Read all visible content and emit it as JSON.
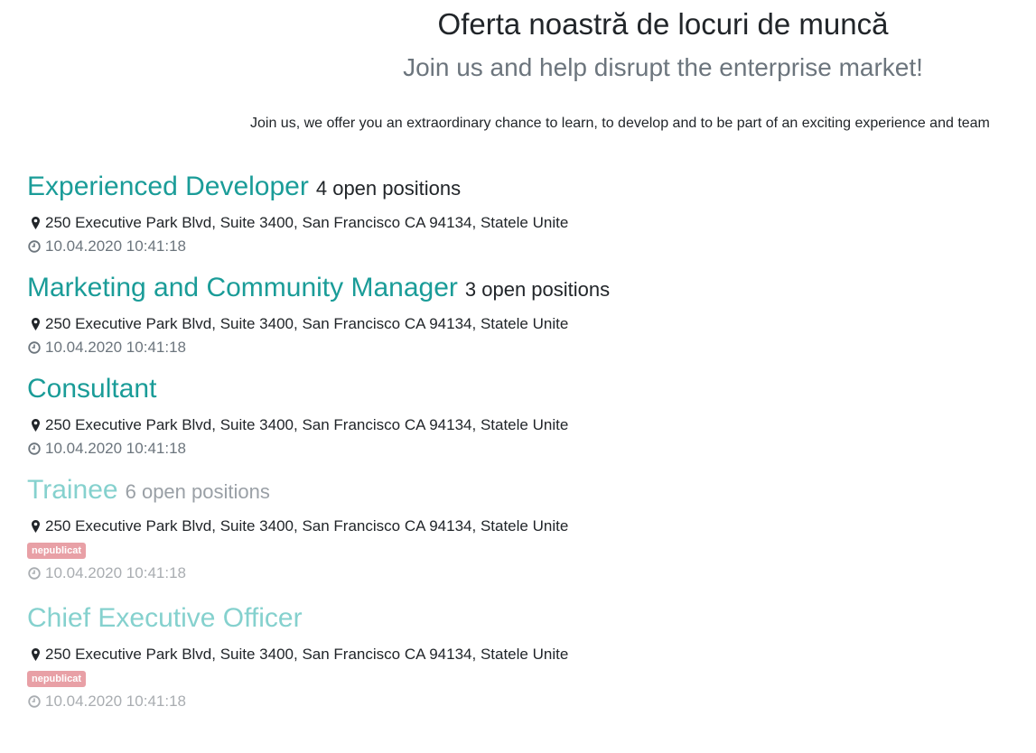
{
  "header": {
    "title": "Oferta noastră de locuri de muncă",
    "subtitle": "Join us and help disrupt the enterprise market!",
    "intro": "Join us, we offer you an extraordinary chance to learn, to develop and to be part of an exciting experience and team"
  },
  "jobs": [
    {
      "title": "Experienced Developer",
      "openings": "4 open positions",
      "address": "250 Executive Park Blvd, Suite 3400, San Francisco CA 94134, Statele Unite",
      "date": "10.04.2020 10:41:18",
      "published": true,
      "badge": ""
    },
    {
      "title": "Marketing and Community Manager",
      "openings": "3 open positions",
      "address": "250 Executive Park Blvd, Suite 3400, San Francisco CA 94134, Statele Unite",
      "date": "10.04.2020 10:41:18",
      "published": true,
      "badge": ""
    },
    {
      "title": "Consultant",
      "openings": "",
      "address": "250 Executive Park Blvd, Suite 3400, San Francisco CA 94134, Statele Unite",
      "date": "10.04.2020 10:41:18",
      "published": true,
      "badge": ""
    },
    {
      "title": "Trainee",
      "openings": "6 open positions",
      "address": "250 Executive Park Blvd, Suite 3400, San Francisco CA 94134, Statele Unite",
      "date": "10.04.2020 10:41:18",
      "published": false,
      "badge": "nepublicat"
    },
    {
      "title": "Chief Executive Officer",
      "openings": "",
      "address": "250 Executive Park Blvd, Suite 3400, San Francisco CA 94134, Statele Unite",
      "date": "10.04.2020 10:41:18",
      "published": false,
      "badge": "nepublicat"
    }
  ],
  "icons": {
    "address": "map-marker-icon",
    "date": "clock-icon"
  },
  "colors": {
    "job_title": "#1a9c98",
    "job_title_unpublished": "#85d1ce",
    "badge": "#e8a0a6"
  }
}
